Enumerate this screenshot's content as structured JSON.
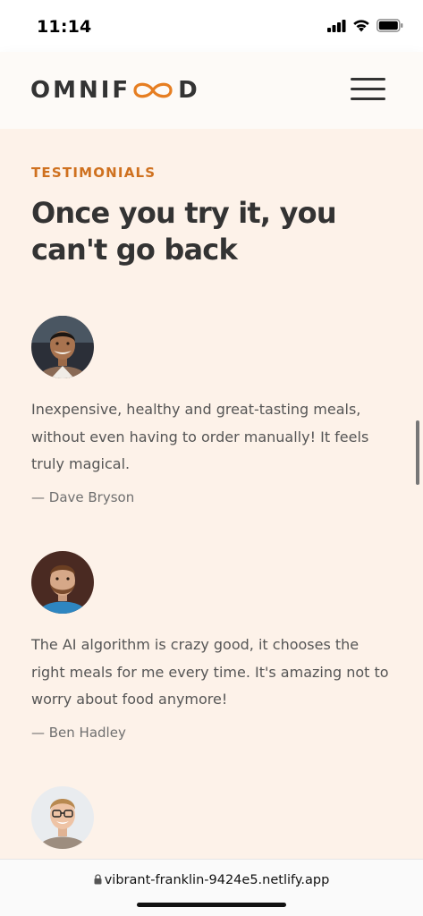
{
  "status_bar": {
    "time": "11:14",
    "icons": [
      "cellular-signal-icon",
      "wifi-icon",
      "battery-icon"
    ]
  },
  "header": {
    "logo_text_left": "OMNIF",
    "logo_text_right": "D",
    "logo_icon": "infinity-icon",
    "menu_icon": "hamburger-menu-icon"
  },
  "testimonials": {
    "subheading": "TESTIMONIALS",
    "heading": "Once you try it, you can't go back",
    "items": [
      {
        "quote": "Inexpensive, healthy and great-tasting meals, without even having to order manually! It feels truly magical.",
        "author": "— Dave Bryson"
      },
      {
        "quote": "The AI algorithm is crazy good, it chooses the right meals for me every time. It's amazing not to worry about food anymore!",
        "author": "— Ben Hadley"
      },
      {
        "quote": "",
        "author": ""
      }
    ]
  },
  "browser": {
    "url": "vibrant-franklin-9424e5.netlify.app",
    "lock_icon": "lock-icon"
  },
  "colors": {
    "accent": "#cf711f",
    "section_background": "#fdf2e9",
    "text_dark": "#333333"
  }
}
